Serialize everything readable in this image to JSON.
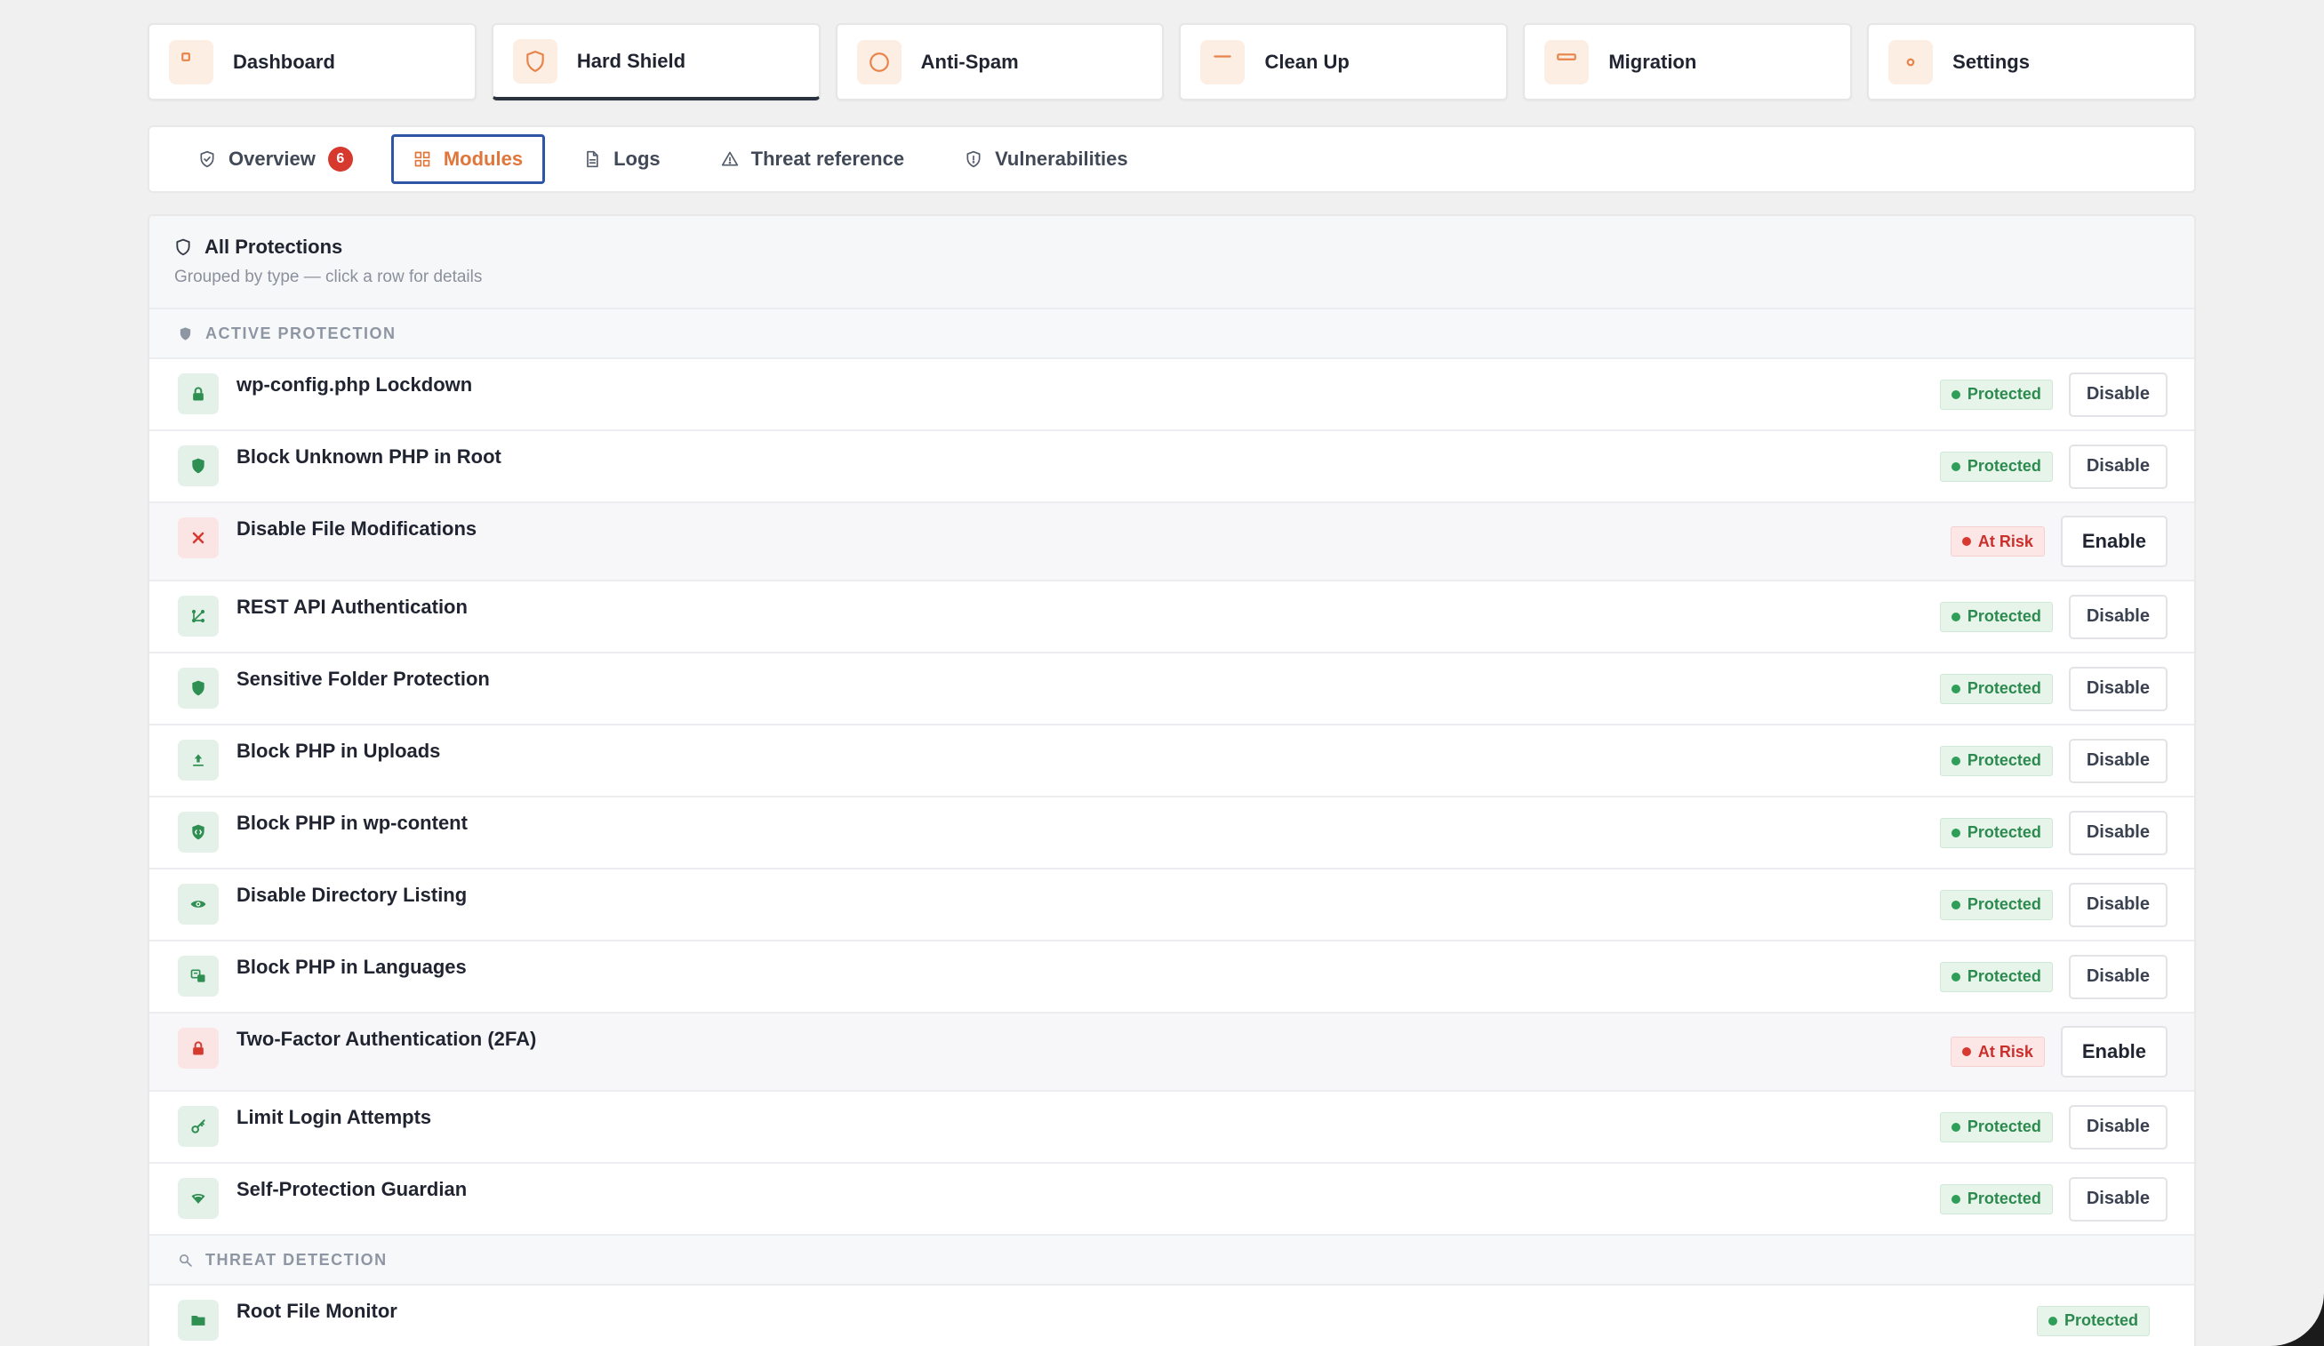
{
  "topnav": [
    {
      "label": "Dashboard",
      "icon": "dashboard-icon",
      "active": false
    },
    {
      "label": "Hard Shield",
      "icon": "shield-icon",
      "active": true
    },
    {
      "label": "Anti-Spam",
      "icon": "ban-icon",
      "active": false
    },
    {
      "label": "Clean Up",
      "icon": "trash-icon",
      "active": false
    },
    {
      "label": "Migration",
      "icon": "archive-icon",
      "active": false
    },
    {
      "label": "Settings",
      "icon": "gear-icon",
      "active": false
    }
  ],
  "subtabs": [
    {
      "label": "Overview",
      "icon": "shield-check-icon",
      "badge": "6",
      "active": false
    },
    {
      "label": "Modules",
      "icon": "grid-icon",
      "active": true
    },
    {
      "label": "Logs",
      "icon": "document-icon",
      "active": false
    },
    {
      "label": "Threat reference",
      "icon": "warning-icon",
      "active": false
    },
    {
      "label": "Vulnerabilities",
      "icon": "shield-alert-icon",
      "active": false
    }
  ],
  "panel": {
    "title": "All Protections",
    "subtitle": "Grouped by type — click a row for details"
  },
  "sections": [
    {
      "title": "ACTIVE PROTECTION",
      "icon": "shield-small-icon",
      "rows": [
        {
          "name": "wp-config.php Lockdown",
          "icon": "lock-icon",
          "status": "Protected",
          "action": "Disable"
        },
        {
          "name": "Block Unknown PHP in Root",
          "icon": "shield-icon",
          "status": "Protected",
          "action": "Disable"
        },
        {
          "name": "Disable File Modifications",
          "icon": "x-icon",
          "status": "At Risk",
          "action": "Enable"
        },
        {
          "name": "REST API Authentication",
          "icon": "nodes-icon",
          "status": "Protected",
          "action": "Disable"
        },
        {
          "name": "Sensitive Folder Protection",
          "icon": "shield-icon",
          "status": "Protected",
          "action": "Disable"
        },
        {
          "name": "Block PHP in Uploads",
          "icon": "upload-icon",
          "status": "Protected",
          "action": "Disable"
        },
        {
          "name": "Block PHP in wp-content",
          "icon": "shield-code-icon",
          "status": "Protected",
          "action": "Disable"
        },
        {
          "name": "Disable Directory Listing",
          "icon": "eye-icon",
          "status": "Protected",
          "action": "Disable"
        },
        {
          "name": "Block PHP in Languages",
          "icon": "translate-icon",
          "status": "Protected",
          "action": "Disable"
        },
        {
          "name": "Two-Factor Authentication (2FA)",
          "icon": "lock-icon",
          "status": "At Risk",
          "action": "Enable"
        },
        {
          "name": "Limit Login Attempts",
          "icon": "key-icon",
          "status": "Protected",
          "action": "Disable"
        },
        {
          "name": "Self-Protection Guardian",
          "icon": "shield-heart-icon",
          "status": "Protected",
          "action": "Disable"
        }
      ]
    },
    {
      "title": "THREAT DETECTION",
      "icon": "search-icon",
      "rows": [
        {
          "name": "Root File Monitor",
          "icon": "folder-icon",
          "status": "Protected",
          "action": ""
        }
      ]
    }
  ],
  "colors": {
    "accent": "#e0763a",
    "protected": "#2c8a4f",
    "at_risk": "#c9302c",
    "active_tab_border": "#2f56a6"
  }
}
